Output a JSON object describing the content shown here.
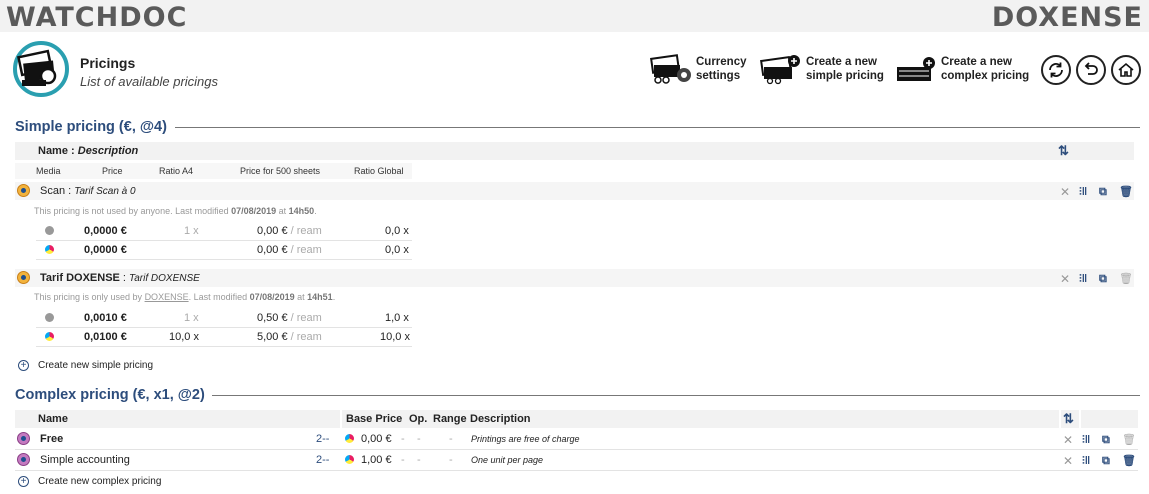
{
  "brand": {
    "left": "WATCHDOC",
    "right": "DOXENSE"
  },
  "page": {
    "title": "Pricings",
    "subtitle": "List of available pricings"
  },
  "toolbar": {
    "currency": [
      "Currency",
      "settings"
    ],
    "simple": [
      "Create a new",
      "simple pricing"
    ],
    "complex": [
      "Create a new",
      "complex pricing"
    ]
  },
  "simple_section": {
    "title": "Simple pricing (€, @4)",
    "header": {
      "name": "Name",
      "sep": " : ",
      "desc": "Description"
    },
    "columns": [
      "Media",
      "Price",
      "Ratio A4",
      "Price for 500 sheets",
      "Ratio Global"
    ],
    "pricings": [
      {
        "name": "Scan",
        "sep": " : ",
        "desc": "Tarif Scan à 0",
        "note_pre": "This pricing is not used by anyone. Last modified ",
        "date": "07/08/2019",
        "at": " at ",
        "time": "14h50",
        "end": ".",
        "rows": [
          {
            "price": "0,0000 €",
            "ratio": "1 x",
            "p500": "0,00 €",
            "ream": " / ream",
            "global": "0,0 x"
          },
          {
            "price": "0,0000 €",
            "ratio": "",
            "p500": "0,00 €",
            "ream": " / ream",
            "global": "0,0 x"
          }
        ]
      },
      {
        "name": "Tarif DOXENSE",
        "sep": " : ",
        "desc": "Tarif DOXENSE",
        "note_pre": "This pricing is only used by ",
        "user": "DOXENSE",
        "note_mid": ". Last modified ",
        "date": "07/08/2019",
        "at": " at ",
        "time": "14h51",
        "end": ".",
        "rows": [
          {
            "price": "0,0010 €",
            "ratio": "1 x",
            "p500": "0,50 €",
            "ream": " / ream",
            "global": "1,0 x"
          },
          {
            "price": "0,0100 €",
            "ratio": "10,0 x",
            "p500": "5,00 €",
            "ream": " / ream",
            "global": "10,0 x"
          }
        ]
      }
    ],
    "create_label": "Create new simple pricing"
  },
  "complex_section": {
    "title": "Complex pricing (€, x1, @2)",
    "columns": {
      "name": "Name",
      "base": "Base Price",
      "op": "Op.",
      "range": "Range",
      "desc": "Description"
    },
    "rows": [
      {
        "name": "Free",
        "count": "2--",
        "base": "0,00 €",
        "op": "-",
        "dash": "-",
        "range": "-",
        "desc": "Printings are free of charge"
      },
      {
        "name": "Simple accounting",
        "count": "2--",
        "base": "1,00 €",
        "op": "-",
        "dash": "-",
        "range": "-",
        "desc": "One unit per page"
      }
    ],
    "create_label": "Create new complex pricing"
  },
  "colors": {
    "accent": "#2d4d7c",
    "brand_orange": "#f08a24"
  }
}
